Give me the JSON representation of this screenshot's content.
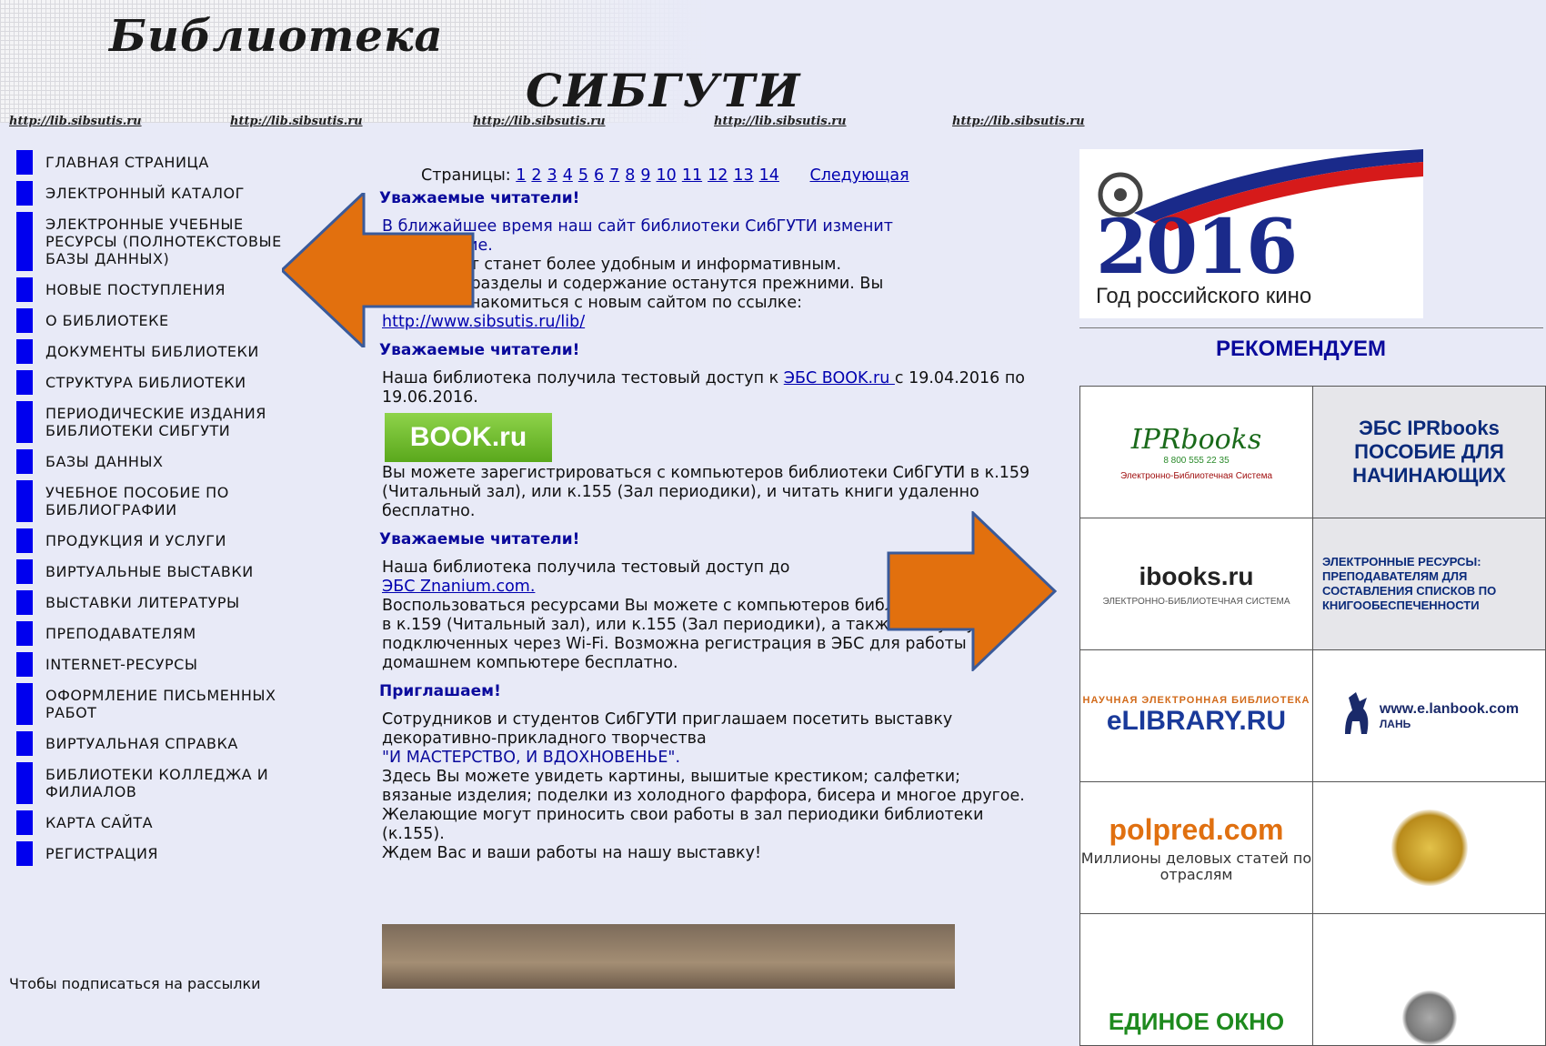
{
  "header": {
    "title_line1": "Библиотека",
    "title_line2": "СИБГУТИ",
    "links": [
      "http://lib.sibsutis.ru",
      "http://lib.sibsutis.ru",
      "http://lib.sibsutis.ru",
      "http://lib.sibsutis.ru",
      "http://lib.sibsutis.ru"
    ]
  },
  "sidebar": {
    "items": [
      {
        "label": "Главная страница"
      },
      {
        "label": "Электронный каталог"
      },
      {
        "label": "Электронные учебные ресурсы (полнотекстовые базы данных)"
      },
      {
        "label": "Новые поступления"
      },
      {
        "label": "О библиотеке"
      },
      {
        "label": "Документы библиотеки"
      },
      {
        "label": "Структура библиотеки"
      },
      {
        "label": "Периодические издания библиотеки СибГУТИ"
      },
      {
        "label": "Базы данных"
      },
      {
        "label": "Учебное пособие по библиографии"
      },
      {
        "label": "Продукция и услуги"
      },
      {
        "label": "Виртуальные выставки"
      },
      {
        "label": "Выставки литературы"
      },
      {
        "label": "Преподавателям"
      },
      {
        "label": "Internet-ресурсы"
      },
      {
        "label": "Оформление письменных работ"
      },
      {
        "label": "Виртуальная справка"
      },
      {
        "label": "Библиотеки колледжа и филиалов"
      },
      {
        "label": "Карта сайта"
      },
      {
        "label": "Регистрация"
      }
    ],
    "footer_text": "Чтобы подписаться на рассылки"
  },
  "pager": {
    "label": "Страницы:",
    "pages": [
      "1",
      "2",
      "3",
      "4",
      "5",
      "6",
      "7",
      "8",
      "9",
      "10",
      "11",
      "12",
      "13",
      "14"
    ],
    "next": "Следующая"
  },
  "news": {
    "n1": {
      "title": "Уважаемые читатели!",
      "line1": "В ближайшее время наш сайт библиотеки СибГУТИ изменит",
      "line2": "оформление.",
      "line3": "Новый сайт станет более удобным и информативным.",
      "line4": "Основные разделы и содержание останутся прежними. Вы",
      "line5": "можете ознакомиться с новым сайтом по ссылке:",
      "link": "http://www.sibsutis.ru/lib/"
    },
    "n2": {
      "title": "Уважаемые читатели!",
      "text_before": "Наша библиотека получила тестовый доступ к ",
      "link": "ЭБС BOOK.ru ",
      "text_after": "с 19.04.2016 по 19.06.2016.",
      "logo": "BOOK.ru",
      "text2": "Вы можете зарегистрироваться с компьютеров библиотеки СибГУТИ в к.159 (Читальный зал), или к.155 (Зал периодики), и читать книги удаленно бесплатно."
    },
    "n3": {
      "title": "Уважаемые читатели!",
      "text_before": "Наша библиотека получила тестовый доступ до",
      "link": "ЭБС Znanium.com.",
      "text2": "Воспользоваться ресурсами Вы можете с компьютеров библиотеки СибГУТИ в к.159 (Читальный зал), или к.155 (Зал периодики), а также с ноутбуков, подключенных через Wi-Fi. Возможна регистрация в ЭБС для работы на домашнем компьютере бесплатно."
    },
    "n4": {
      "title": "Приглашаем!",
      "text1": "Сотрудников и студентов СибГУТИ приглашаем посетить выставку декоративно-прикладного творчества",
      "quote": "\"И МАСТЕРСТВО, И ВДОХНОВЕНЬЕ\".",
      "text2": "Здесь Вы можете увидеть картины, вышитые крестиком; салфетки; вязаные изделия; поделки из холодного фарфора, бисера и многое другое.",
      "text3": "Желающие могут приносить свои работы в зал периодики библиотеки (к.155).",
      "text4": "Ждем Вас и ваши работы на нашу выставку!"
    }
  },
  "right": {
    "banner_year": "2016",
    "banner_caption": "Год российского кино",
    "recommend": "РЕКОМЕНДУЕМ",
    "tiles": {
      "ipr_logo": "IPRbooks",
      "ipr_phone": "8 800 555 22 35",
      "ipr_sub": "Электронно-Библиотечная Система",
      "ipr_title": "ЭБС IPRbooks ПОСОБИЕ ДЛЯ НАЧИНАЮЩИХ",
      "ibooks": "ibooks.ru",
      "ibooks_sub": "ЭЛЕКТРОННО-БИБЛИОТЕЧНАЯ СИСТЕМА",
      "res_text": "ЭЛЕКТРОННЫЕ РЕСУРСЫ: ПРЕПОДАВАТЕЛЯМ ДЛЯ СОСТАВЛЕНИЯ СПИСКОВ ПО КНИГООБЕСПЕЧЕННОСТИ",
      "elib_top": "НАУЧНАЯ ЭЛЕКТРОННАЯ БИБЛИОТЕКА",
      "elib": "eLIBRARY.RU",
      "lan": "www.e.lanbook.com",
      "lan_name": "ЛАНЬ",
      "polpred": "polpred.com",
      "polpred_sub": "Миллионы деловых статей по отраслям",
      "okno": "ЕДИНОЕ ОКНО"
    }
  },
  "colors": {
    "background": "#e8eaf7",
    "nav_bar": "#0000ee",
    "heading": "#0a0a9c",
    "arrow": "#e2700e"
  }
}
